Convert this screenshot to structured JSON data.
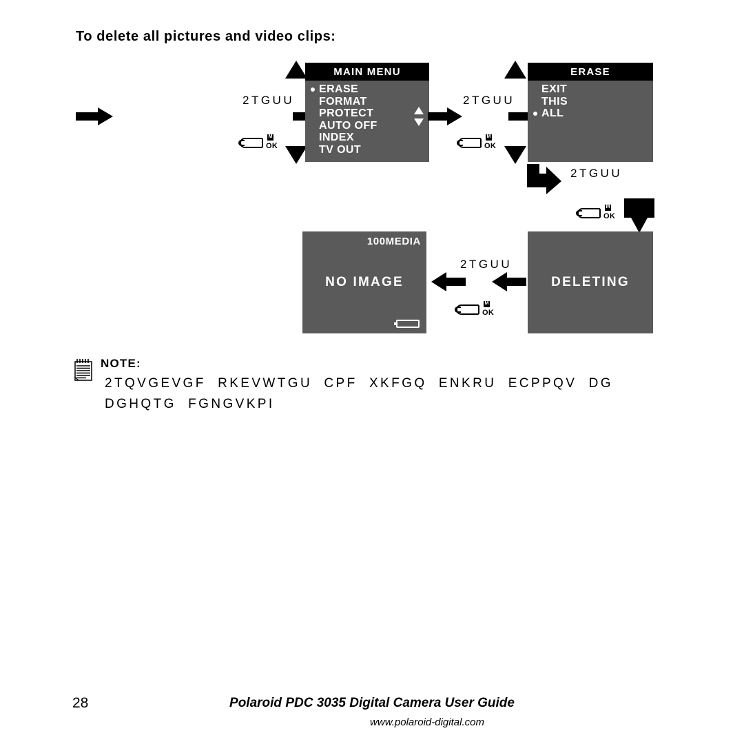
{
  "page": {
    "heading": "To delete all pictures and video clips:",
    "page_number": "28",
    "footer_title": "Polaroid PDC 3035 Digital Camera User Guide",
    "footer_url": "www.polaroid-digital.com",
    "colors": {
      "lcd_background": "#5a5a5a",
      "lcd_title_bar": "#000000",
      "lcd_text": "#ffffff",
      "ink": "#000000",
      "paper": "#ffffff"
    }
  },
  "screens": [
    {
      "id": "main-menu",
      "title": "MAIN MENU",
      "items": [
        "ERASE",
        "FORMAT",
        "PROTECT",
        "AUTO OFF",
        "INDEX",
        "TV OUT"
      ],
      "selected": "ERASE",
      "scroll_indicator": true
    },
    {
      "id": "erase",
      "title": "ERASE",
      "items": [
        "EXIT",
        "THIS",
        "ALL"
      ],
      "selected": "ALL",
      "scroll_indicator": false
    },
    {
      "id": "deleting",
      "center_label": "DELETING"
    },
    {
      "id": "no-image",
      "center_label": "NO IMAGE",
      "corner_label": "100MEDIA",
      "battery_icon": true
    }
  ],
  "press_labels": [
    {
      "id": "press-1",
      "text": "2TGUU"
    },
    {
      "id": "press-2",
      "text": "2TGUU"
    },
    {
      "id": "press-3",
      "text": "2TGUU"
    },
    {
      "id": "press-4",
      "text": "2TGUU"
    }
  ],
  "button_icons": [
    {
      "id": "btn-1",
      "badge": "M",
      "label": "OK"
    },
    {
      "id": "btn-2",
      "badge": "M",
      "label": "OK"
    },
    {
      "id": "btn-3",
      "badge": "M",
      "label": "OK"
    },
    {
      "id": "btn-4",
      "badge": "M",
      "label": "OK"
    }
  ],
  "note": {
    "label": "NOTE:",
    "line1": "2TQVGEVGF  RKEVWTGU  CPF  XKFGQ  ENKRU  ECPPQV  DG",
    "line2": "DGHQTG  FGNGVKPI"
  }
}
